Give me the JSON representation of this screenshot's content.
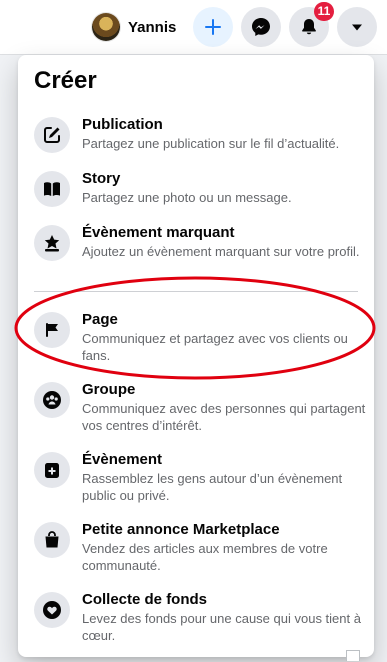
{
  "header": {
    "profile_name": "Yannis",
    "notification_count": "11",
    "icons": {
      "create": "plus-icon",
      "messenger": "messenger-icon",
      "notifications": "bell-icon",
      "account": "caret-down-icon"
    }
  },
  "menu": {
    "title": "Créer",
    "items": [
      {
        "label": "Publication",
        "description": "Partagez une publication sur le fil d’actualité.",
        "icon": "compose-icon"
      },
      {
        "label": "Story",
        "description": "Partagez une photo ou un message.",
        "icon": "book-icon"
      },
      {
        "label": "Évènement marquant",
        "description": "Ajoutez un évènement marquant sur votre profil.",
        "icon": "star-icon"
      },
      {
        "label": "Page",
        "description": "Communiquez et partagez avec vos clients ou fans.",
        "icon": "flag-icon"
      },
      {
        "label": "Groupe",
        "description": "Communiquez avec des personnes qui partagent vos centres d’intérêt.",
        "icon": "group-icon"
      },
      {
        "label": "Évènement",
        "description": "Rassemblez les gens autour d’un évènement public ou privé.",
        "icon": "calendar-plus-icon"
      },
      {
        "label": "Petite annonce Marketplace",
        "description": "Vendez des articles aux membres de votre communauté.",
        "icon": "shopping-bag-icon"
      },
      {
        "label": "Collecte de fonds",
        "description": "Levez des fonds pour une cause qui vous tient à cœur.",
        "icon": "heart-hand-icon"
      }
    ]
  },
  "colors": {
    "accent": "#1877f2",
    "badge": "#e41e3f",
    "annotation": "#e0000f"
  }
}
